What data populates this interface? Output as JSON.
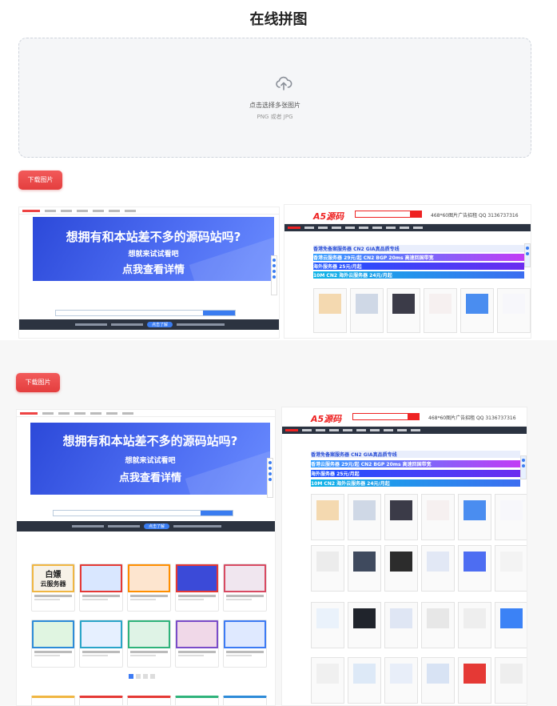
{
  "page": {
    "title": "在线拼图"
  },
  "upload": {
    "icon": "upload-cloud-icon",
    "main_text": "点击选择多张图片",
    "hint_text": "PNG 或者 JPG"
  },
  "results": [
    {
      "download_label": "下载图片"
    },
    {
      "download_label": "下载图片"
    }
  ],
  "left_site": {
    "banner_headline": "想拥有和本站差不多的源码站吗?",
    "banner_sub": "想就来试试看吧",
    "banner_cta": "点我查看详情",
    "notice_pill": "点击了解",
    "card_big_text_1": "白嫖",
    "card_big_text_2": "云服务器"
  },
  "right_site": {
    "logo": "A5源码",
    "ad_text": "468*60图片广告招租  QQ 3136737316",
    "ads": [
      "香港免备案服务器  CN2 GIA真品质专线",
      "香港云服务器 29元/起  CN2 BGP 20ms 高速回国带宽",
      "海外服务器 25元/月起",
      "10M CN2 海外云服务器 24元/月起"
    ]
  },
  "colors": {
    "accent_red": "#e84646",
    "banner_blue": "#3556e6",
    "site_red": "#e22222",
    "dark_nav": "#2b3341"
  }
}
